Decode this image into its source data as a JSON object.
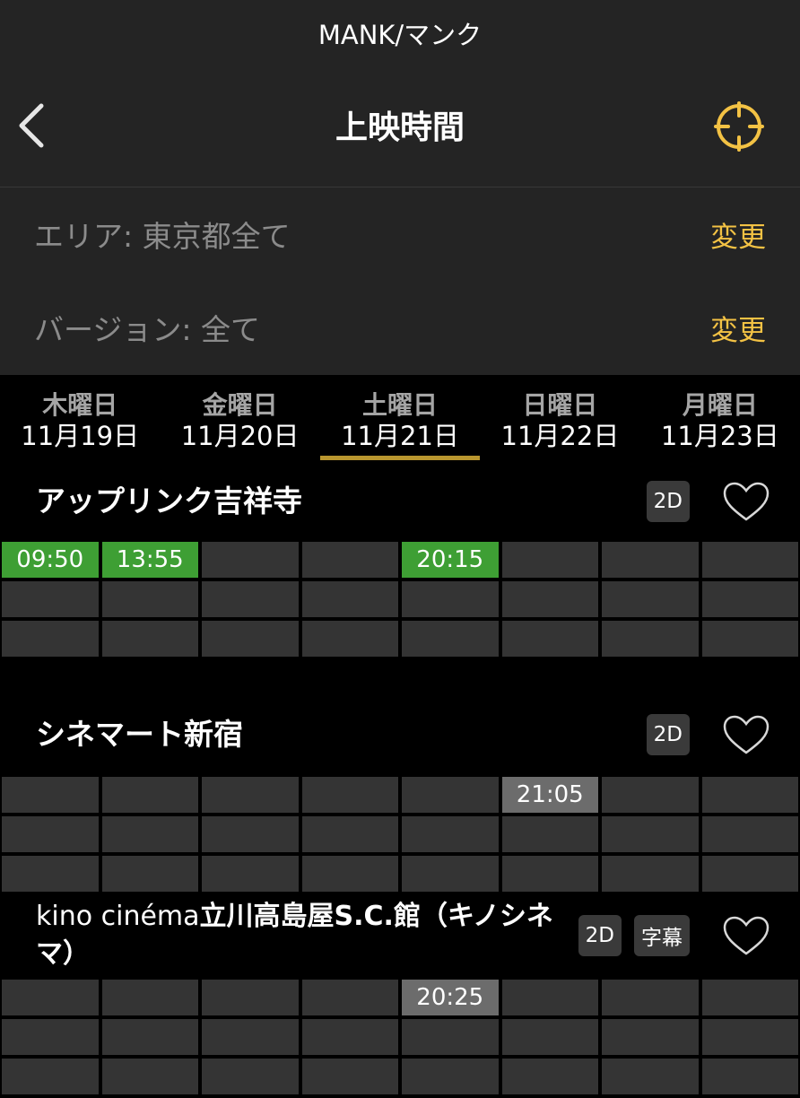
{
  "app": {
    "title": "MANK/マンク"
  },
  "nav": {
    "title": "上映時間",
    "back_icon": "chevron-left-icon",
    "locate_icon": "crosshair-icon"
  },
  "filters": {
    "area_label": "エリア: 東京都全て",
    "version_label": "バージョン: 全て",
    "change_label": "変更"
  },
  "days": [
    {
      "weekday": "木曜日",
      "date": "11月19日"
    },
    {
      "weekday": "金曜日",
      "date": "11月20日"
    },
    {
      "weekday": "土曜日",
      "date": "11月21日"
    },
    {
      "weekday": "日曜日",
      "date": "11月22日"
    },
    {
      "weekday": "月曜日",
      "date": "11月23日"
    }
  ],
  "theaters": [
    {
      "name": "アップリンク吉祥寺",
      "tags": [
        "2D"
      ],
      "showtimes": [
        {
          "col": 0,
          "time": "09:50",
          "status": "green"
        },
        {
          "col": 1,
          "time": "13:55",
          "status": "green"
        },
        {
          "col": 4,
          "time": "20:15",
          "status": "green"
        }
      ]
    },
    {
      "name": "シネマート新宿",
      "tags": [
        "2D"
      ],
      "showtimes": [
        {
          "col": 5,
          "time": "21:05",
          "status": "grey"
        }
      ]
    },
    {
      "name_prefix": "kino cinéma",
      "name": "立川高島屋S.C.館（キノシネマ）",
      "tags": [
        "2D",
        "字幕"
      ],
      "showtimes": [
        {
          "col": 4,
          "time": "20:25",
          "status": "grey"
        }
      ]
    }
  ],
  "colors": {
    "accent": "#f3c244",
    "tab_underline": "#b9962f",
    "available": "#3e9f34",
    "few_seats": "#6c6c6c"
  }
}
